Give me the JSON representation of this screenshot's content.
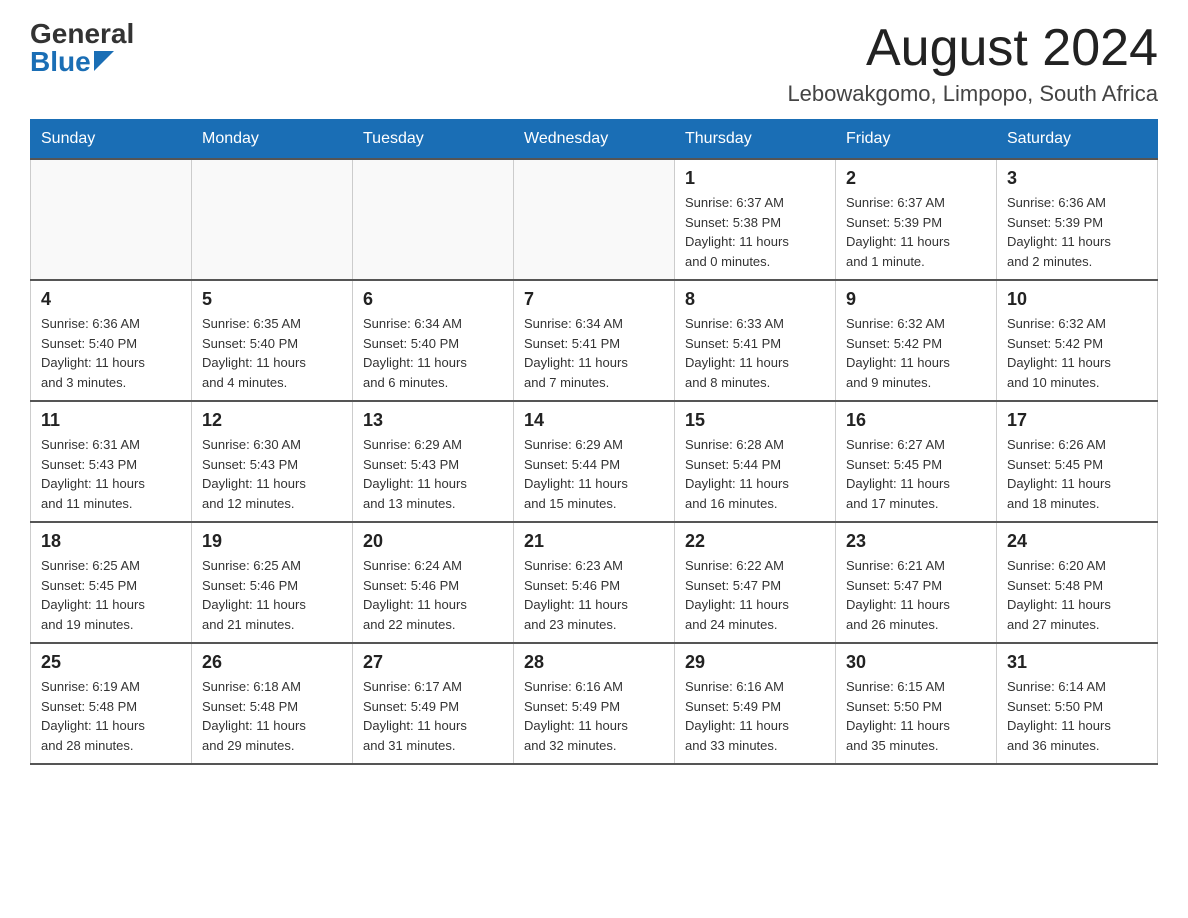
{
  "header": {
    "logo_general": "General",
    "logo_blue": "Blue",
    "month_title": "August 2024",
    "location": "Lebowakgomo, Limpopo, South Africa"
  },
  "days_of_week": [
    "Sunday",
    "Monday",
    "Tuesday",
    "Wednesday",
    "Thursday",
    "Friday",
    "Saturday"
  ],
  "weeks": [
    [
      {
        "day": "",
        "info": ""
      },
      {
        "day": "",
        "info": ""
      },
      {
        "day": "",
        "info": ""
      },
      {
        "day": "",
        "info": ""
      },
      {
        "day": "1",
        "info": "Sunrise: 6:37 AM\nSunset: 5:38 PM\nDaylight: 11 hours\nand 0 minutes."
      },
      {
        "day": "2",
        "info": "Sunrise: 6:37 AM\nSunset: 5:39 PM\nDaylight: 11 hours\nand 1 minute."
      },
      {
        "day": "3",
        "info": "Sunrise: 6:36 AM\nSunset: 5:39 PM\nDaylight: 11 hours\nand 2 minutes."
      }
    ],
    [
      {
        "day": "4",
        "info": "Sunrise: 6:36 AM\nSunset: 5:40 PM\nDaylight: 11 hours\nand 3 minutes."
      },
      {
        "day": "5",
        "info": "Sunrise: 6:35 AM\nSunset: 5:40 PM\nDaylight: 11 hours\nand 4 minutes."
      },
      {
        "day": "6",
        "info": "Sunrise: 6:34 AM\nSunset: 5:40 PM\nDaylight: 11 hours\nand 6 minutes."
      },
      {
        "day": "7",
        "info": "Sunrise: 6:34 AM\nSunset: 5:41 PM\nDaylight: 11 hours\nand 7 minutes."
      },
      {
        "day": "8",
        "info": "Sunrise: 6:33 AM\nSunset: 5:41 PM\nDaylight: 11 hours\nand 8 minutes."
      },
      {
        "day": "9",
        "info": "Sunrise: 6:32 AM\nSunset: 5:42 PM\nDaylight: 11 hours\nand 9 minutes."
      },
      {
        "day": "10",
        "info": "Sunrise: 6:32 AM\nSunset: 5:42 PM\nDaylight: 11 hours\nand 10 minutes."
      }
    ],
    [
      {
        "day": "11",
        "info": "Sunrise: 6:31 AM\nSunset: 5:43 PM\nDaylight: 11 hours\nand 11 minutes."
      },
      {
        "day": "12",
        "info": "Sunrise: 6:30 AM\nSunset: 5:43 PM\nDaylight: 11 hours\nand 12 minutes."
      },
      {
        "day": "13",
        "info": "Sunrise: 6:29 AM\nSunset: 5:43 PM\nDaylight: 11 hours\nand 13 minutes."
      },
      {
        "day": "14",
        "info": "Sunrise: 6:29 AM\nSunset: 5:44 PM\nDaylight: 11 hours\nand 15 minutes."
      },
      {
        "day": "15",
        "info": "Sunrise: 6:28 AM\nSunset: 5:44 PM\nDaylight: 11 hours\nand 16 minutes."
      },
      {
        "day": "16",
        "info": "Sunrise: 6:27 AM\nSunset: 5:45 PM\nDaylight: 11 hours\nand 17 minutes."
      },
      {
        "day": "17",
        "info": "Sunrise: 6:26 AM\nSunset: 5:45 PM\nDaylight: 11 hours\nand 18 minutes."
      }
    ],
    [
      {
        "day": "18",
        "info": "Sunrise: 6:25 AM\nSunset: 5:45 PM\nDaylight: 11 hours\nand 19 minutes."
      },
      {
        "day": "19",
        "info": "Sunrise: 6:25 AM\nSunset: 5:46 PM\nDaylight: 11 hours\nand 21 minutes."
      },
      {
        "day": "20",
        "info": "Sunrise: 6:24 AM\nSunset: 5:46 PM\nDaylight: 11 hours\nand 22 minutes."
      },
      {
        "day": "21",
        "info": "Sunrise: 6:23 AM\nSunset: 5:46 PM\nDaylight: 11 hours\nand 23 minutes."
      },
      {
        "day": "22",
        "info": "Sunrise: 6:22 AM\nSunset: 5:47 PM\nDaylight: 11 hours\nand 24 minutes."
      },
      {
        "day": "23",
        "info": "Sunrise: 6:21 AM\nSunset: 5:47 PM\nDaylight: 11 hours\nand 26 minutes."
      },
      {
        "day": "24",
        "info": "Sunrise: 6:20 AM\nSunset: 5:48 PM\nDaylight: 11 hours\nand 27 minutes."
      }
    ],
    [
      {
        "day": "25",
        "info": "Sunrise: 6:19 AM\nSunset: 5:48 PM\nDaylight: 11 hours\nand 28 minutes."
      },
      {
        "day": "26",
        "info": "Sunrise: 6:18 AM\nSunset: 5:48 PM\nDaylight: 11 hours\nand 29 minutes."
      },
      {
        "day": "27",
        "info": "Sunrise: 6:17 AM\nSunset: 5:49 PM\nDaylight: 11 hours\nand 31 minutes."
      },
      {
        "day": "28",
        "info": "Sunrise: 6:16 AM\nSunset: 5:49 PM\nDaylight: 11 hours\nand 32 minutes."
      },
      {
        "day": "29",
        "info": "Sunrise: 6:16 AM\nSunset: 5:49 PM\nDaylight: 11 hours\nand 33 minutes."
      },
      {
        "day": "30",
        "info": "Sunrise: 6:15 AM\nSunset: 5:50 PM\nDaylight: 11 hours\nand 35 minutes."
      },
      {
        "day": "31",
        "info": "Sunrise: 6:14 AM\nSunset: 5:50 PM\nDaylight: 11 hours\nand 36 minutes."
      }
    ]
  ]
}
